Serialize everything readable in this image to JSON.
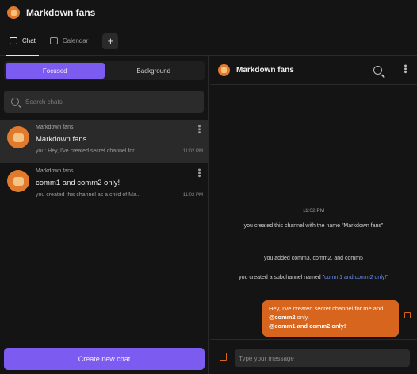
{
  "app": {
    "title": "Markdown fans"
  },
  "tabs": [
    {
      "label": "Chat",
      "icon": "chat-bubble-icon"
    },
    {
      "label": "Calendar",
      "icon": "calendar-icon"
    }
  ],
  "add_tab_label": "+",
  "sidebar": {
    "segments": [
      "Focused",
      "Background"
    ],
    "search_placeholder": "Search chats",
    "chats": [
      {
        "group": "Markdown fans",
        "name": "Markdown fans",
        "preview": "you: Hey, I've created secret channel for ...",
        "time": "11:02 PM"
      },
      {
        "group": "Markdown fans",
        "name": "comm1 and comm2 only!",
        "preview": "you created this channel as a child of Ma...",
        "time": "11:02 PM"
      }
    ],
    "create_button": "Create new chat"
  },
  "conversation": {
    "title": "Markdown fans",
    "timestamp": "11:02 PM",
    "system_messages": [
      "you created this channel with the name \"Markdown fans\"",
      "you added comm3, comm2, and comm5"
    ],
    "subchannel_prefix": "you created a subchannel named \"",
    "subchannel_link": "comm1 and comm2 only!",
    "subchannel_suffix": "\"",
    "bubble": {
      "text_before": "Hey, I've created secret channel for me and ",
      "mention": "@comm2",
      "text_after": " only.",
      "bold_line": "@comm1 and comm2 only!"
    },
    "composer_placeholder": "Type your message"
  },
  "colors": {
    "accent": "#7c5cf0",
    "brand": "#e07a2c",
    "bubble": "#d8651e",
    "link": "#6c8df5"
  }
}
